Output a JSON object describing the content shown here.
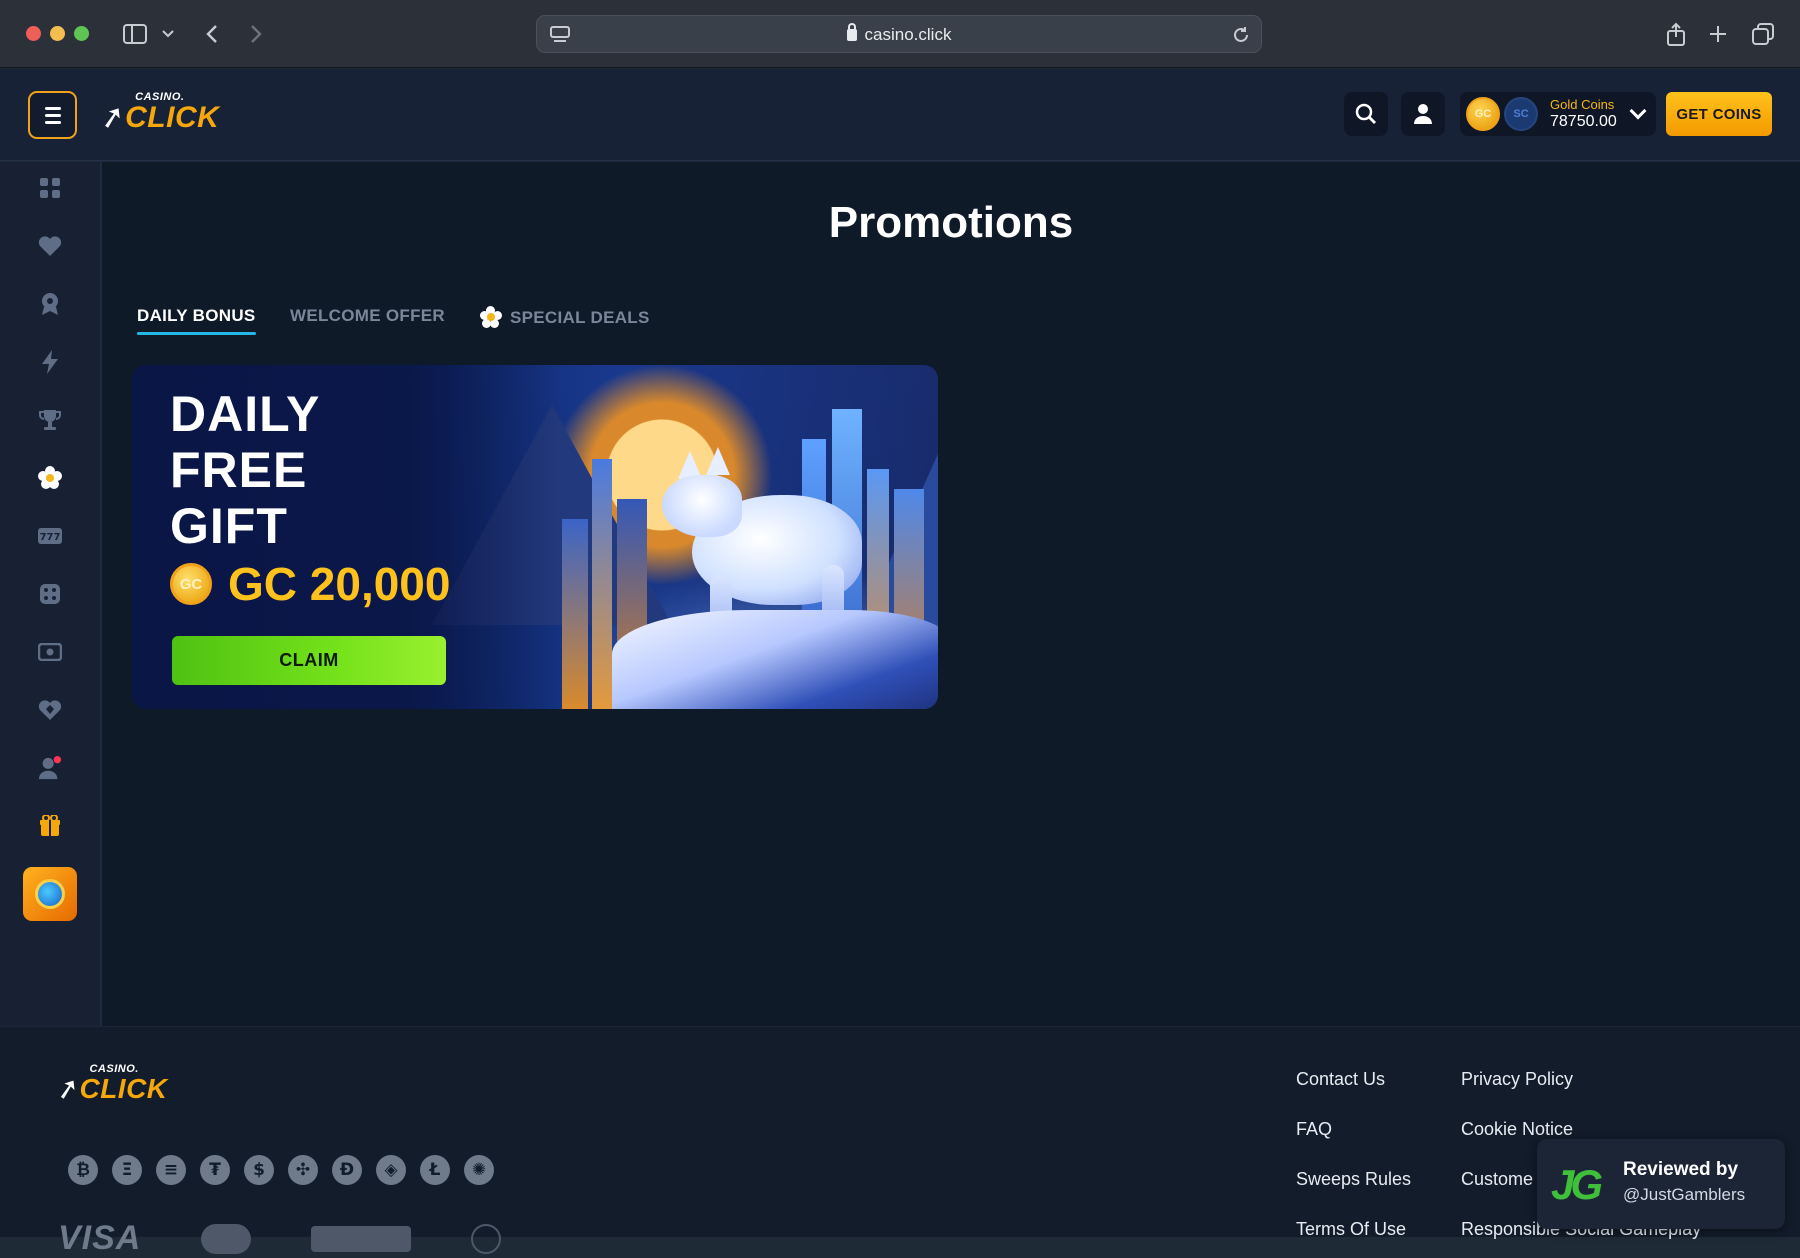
{
  "browser": {
    "url": "casino.click"
  },
  "header": {
    "logo_small": "CASINO.",
    "logo_big": "CLICK",
    "coin_gc": "GC",
    "coin_sc": "SC",
    "currency_label": "Gold Coins",
    "currency_value": "78750.00",
    "get_coins_label": "GET COINS"
  },
  "sidebar": {
    "items": [
      {
        "icon": "grid-icon",
        "glyph": "▦"
      },
      {
        "icon": "heart-icon",
        "glyph": "♥"
      },
      {
        "icon": "badge-icon",
        "glyph": "✪"
      },
      {
        "icon": "lightning-icon",
        "glyph": "⚡"
      },
      {
        "icon": "trophy-icon",
        "glyph": "🏆"
      },
      {
        "icon": "flower-icon",
        "glyph": "✿"
      },
      {
        "icon": "slots-icon",
        "glyph": "7"
      },
      {
        "icon": "dice-icon",
        "glyph": "⚄"
      },
      {
        "icon": "card-icon",
        "glyph": "▭"
      },
      {
        "icon": "diamond-heart-icon",
        "glyph": "♦"
      },
      {
        "icon": "live-dealer-icon",
        "glyph": "☺"
      },
      {
        "icon": "gift-icon",
        "glyph": "🎁"
      }
    ]
  },
  "main": {
    "title": "Promotions",
    "tabs": [
      {
        "label": "DAILY BONUS"
      },
      {
        "label": "WELCOME OFFER"
      },
      {
        "label": "SPECIAL DEALS"
      }
    ],
    "promo": {
      "line1": "DAILY",
      "line2": "FREE",
      "line3": "GIFT",
      "coin": "GC",
      "amount": "GC 20,000",
      "claim_label": "CLAIM"
    }
  },
  "footer": {
    "logo_small": "CASINO.",
    "logo_big": "CLICK",
    "crypto": [
      "₿",
      "Ξ",
      "≡",
      "₮",
      "$",
      "✣",
      "Ð",
      "◈",
      "Ł",
      "✺"
    ],
    "payment_visa": "VISA",
    "links": [
      {
        "label": "Contact Us"
      },
      {
        "label": "FAQ"
      },
      {
        "label": "Sweeps Rules"
      },
      {
        "label": "Terms Of Use"
      },
      {
        "label": "Privacy Policy"
      },
      {
        "label": "Cookie Notice"
      },
      {
        "label": "Custome"
      },
      {
        "label": "Responsible Social Gameplay"
      }
    ],
    "review": {
      "logo": "JG",
      "title": "Reviewed by",
      "handle": "@JustGamblers"
    }
  },
  "colors": {
    "accent_gold": "#f5a70b",
    "tab_underline": "#24b7e6",
    "claim_green": "#74e21a",
    "page_bg": "#0f1a29"
  }
}
